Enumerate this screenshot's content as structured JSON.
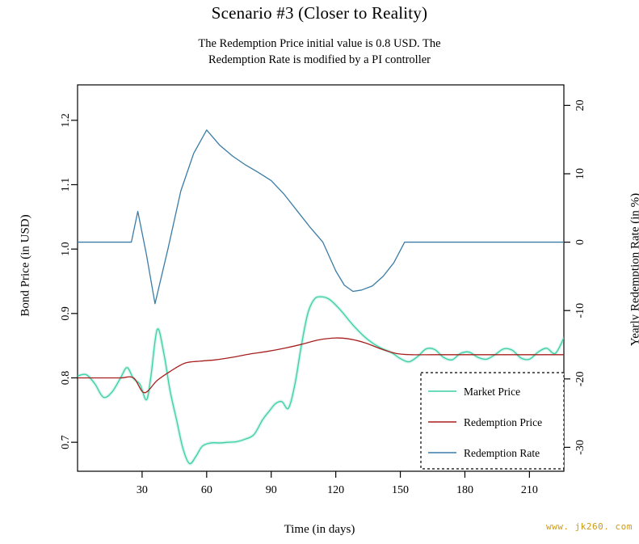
{
  "title": "Scenario #3 (Closer to Reality)",
  "subtitle_line1": "The Redemption Price initial value is 0.8 USD. The",
  "subtitle_line2": "Redemption Rate is modified by a PI controller",
  "watermark": "www. jk260. com",
  "colors": {
    "market_price": "#3CCFA5",
    "redemption_price": "#A81F1F",
    "redemption_rate": "#3A7CA5",
    "axis": "#000000",
    "watermark": "#CC9A12",
    "background": "#FFFFFF"
  },
  "legend": {
    "border_style": "dashed",
    "items": [
      {
        "label": "Market Price",
        "color": "#3CCFA5"
      },
      {
        "label": "Redemption Price",
        "color": "#A81F1F"
      },
      {
        "label": "Redemption Rate",
        "color": "#3A7CA5"
      }
    ]
  },
  "chart_data": {
    "type": "line",
    "title": "Scenario #3 (Closer to Reality)",
    "subtitle": "The Redemption Price initial value is 0.8 USD. The Redemption Rate is modified by a PI controller",
    "xlabel": "Time (in days)",
    "ylabel": "Bond Price (in USD)",
    "y2label": "Yearly Redemption Rate (in %)",
    "xlim": [
      0,
      226
    ],
    "ylim": [
      0.655,
      1.255
    ],
    "y2lim": [
      -33.5,
      23.0
    ],
    "xticks": [
      30,
      60,
      90,
      120,
      150,
      180,
      210
    ],
    "yticks": [
      0.7,
      0.8,
      0.9,
      1.0,
      1.1,
      1.2
    ],
    "y2ticks": [
      -30,
      -20,
      -10,
      0,
      10,
      20
    ],
    "grid": false,
    "legend_position": "bottom-right",
    "series": [
      {
        "name": "Market Price",
        "color": "#3CCFA5",
        "axis": "left",
        "unit": "USD",
        "x": [
          0,
          4,
          8,
          12,
          16,
          20,
          23,
          26,
          29,
          32,
          34,
          37,
          40,
          43,
          46,
          49,
          52,
          55,
          58,
          62,
          66,
          70,
          74,
          78,
          82,
          86,
          89,
          92,
          95,
          98,
          101,
          104,
          107,
          110,
          113,
          117,
          122,
          128,
          134,
          140,
          146,
          150,
          154,
          158,
          162,
          166,
          170,
          174,
          178,
          182,
          186,
          190,
          194,
          198,
          202,
          206,
          210,
          214,
          218,
          222,
          226
        ],
        "y": [
          0.803,
          0.805,
          0.791,
          0.77,
          0.778,
          0.8,
          0.816,
          0.799,
          0.79,
          0.766,
          0.8,
          0.875,
          0.84,
          0.78,
          0.735,
          0.69,
          0.667,
          0.678,
          0.694,
          0.699,
          0.699,
          0.7,
          0.701,
          0.705,
          0.712,
          0.735,
          0.748,
          0.76,
          0.763,
          0.753,
          0.79,
          0.85,
          0.9,
          0.922,
          0.926,
          0.922,
          0.906,
          0.882,
          0.862,
          0.848,
          0.839,
          0.83,
          0.825,
          0.833,
          0.845,
          0.844,
          0.832,
          0.828,
          0.838,
          0.84,
          0.832,
          0.829,
          0.836,
          0.845,
          0.843,
          0.831,
          0.829,
          0.84,
          0.846,
          0.838,
          0.862
        ]
      },
      {
        "name": "Redemption Price",
        "color": "#A81F1F",
        "axis": "left",
        "unit": "USD",
        "x": [
          0,
          10,
          20,
          26,
          31,
          37,
          43,
          50,
          57,
          64,
          72,
          80,
          88,
          96,
          104,
          112,
          120,
          127,
          134,
          141,
          148,
          155,
          165,
          180,
          195,
          210,
          226
        ],
        "y": [
          0.8,
          0.8,
          0.8,
          0.8,
          0.777,
          0.796,
          0.81,
          0.823,
          0.826,
          0.828,
          0.832,
          0.837,
          0.841,
          0.846,
          0.852,
          0.859,
          0.862,
          0.86,
          0.854,
          0.845,
          0.838,
          0.836,
          0.836,
          0.836,
          0.836,
          0.836,
          0.836
        ]
      },
      {
        "name": "Redemption Rate",
        "color": "#3A7CA5",
        "axis": "right",
        "unit": "%",
        "x": [
          0,
          8,
          16,
          22,
          25,
          28,
          32,
          36,
          42,
          48,
          54,
          60,
          66,
          72,
          78,
          84,
          90,
          96,
          102,
          108,
          114,
          120,
          124,
          128,
          132,
          137,
          142,
          147,
          152,
          160,
          175,
          190,
          205,
          226
        ],
        "y": [
          0.0,
          0.0,
          0.0,
          0.0,
          0.0,
          4.5,
          -1.8,
          -9.0,
          -1.0,
          7.5,
          13.0,
          16.4,
          14.2,
          12.6,
          11.3,
          10.2,
          9.0,
          7.0,
          4.6,
          2.2,
          0.0,
          -4.2,
          -6.3,
          -7.2,
          -7.0,
          -6.4,
          -5.0,
          -3.0,
          0.0,
          0.0,
          0.0,
          0.0,
          0.0,
          0.0
        ]
      }
    ]
  }
}
